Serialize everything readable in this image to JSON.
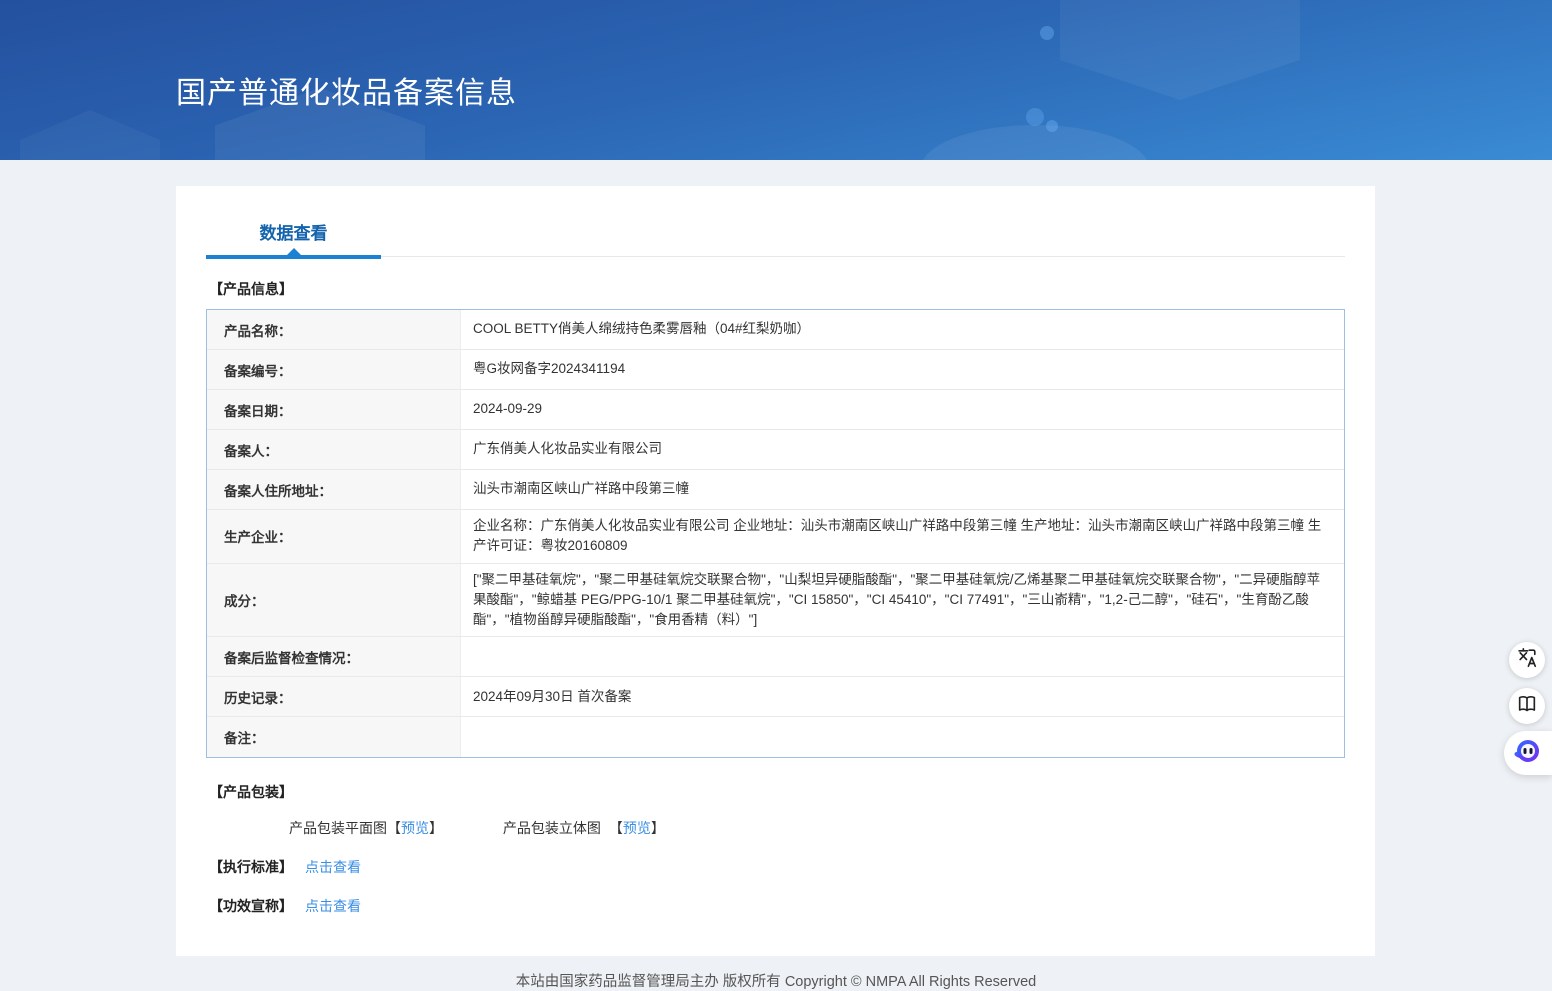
{
  "header": {
    "title": "国产普通化妆品备案信息"
  },
  "tabs": {
    "data_view": "数据查看"
  },
  "product_info": {
    "section_title": "【产品信息】",
    "rows": [
      {
        "label": "产品名称：",
        "value": "COOL BETTY俏美人绵绒持色柔雾唇釉（04#红梨奶咖）"
      },
      {
        "label": "备案编号：",
        "value": "粤G妆网备字2024341194"
      },
      {
        "label": "备案日期：",
        "value": "2024-09-29"
      },
      {
        "label": "备案人：",
        "value": "广东俏美人化妆品实业有限公司"
      },
      {
        "label": "备案人住所地址：",
        "value": "汕头市潮南区峡山广祥路中段第三幢"
      },
      {
        "label": "生产企业：",
        "value": "企业名称：广东俏美人化妆品实业有限公司 企业地址：汕头市潮南区峡山广祥路中段第三幢 生产地址：汕头市潮南区峡山广祥路中段第三幢 生产许可证：粤妆20160809"
      },
      {
        "label": "成分：",
        "value": "[\"聚二甲基硅氧烷\"，\"聚二甲基硅氧烷交联聚合物\"，\"山梨坦异硬脂酸酯\"，\"聚二甲基硅氧烷/乙烯基聚二甲基硅氧烷交联聚合物\"，\"二异硬脂醇苹果酸酯\"，\"鲸蜡基 PEG/PPG-10/1 聚二甲基硅氧烷\"，\"CI 15850\"，\"CI 45410\"，\"CI 77491\"，\"三山嵛精\"，\"1,2-己二醇\"，\"硅石\"，\"生育酚乙酸酯\"，\"植物甾醇异硬脂酸酯\"，\"食用香精（料）\"]"
      },
      {
        "label": "备案后监督检查情况：",
        "value": ""
      },
      {
        "label": "历史记录：",
        "value": "2024年09月30日 首次备案"
      },
      {
        "label": "备注：",
        "value": ""
      }
    ]
  },
  "packaging": {
    "section_title": "【产品包装】",
    "flat_label": "产品包装平面图",
    "stereo_label": "产品包装立体图",
    "bracket_open": "【",
    "preview_link": "预览",
    "bracket_close": "】"
  },
  "standards": {
    "label": "【执行标准】",
    "link": "点击查看"
  },
  "efficacy": {
    "label": "【功效宣称】",
    "link": "点击查看"
  },
  "floating_buttons": {
    "translate": "translate-icon",
    "reader": "book-reader-icon",
    "assistant": "ai-assistant-icon"
  },
  "footer": {
    "text": "本站由国家药品监督管理局主办 版权所有 Copyright © NMPA All Rights Reserved"
  },
  "colors": {
    "header_gradient_from": "#24509f",
    "header_gradient_to": "#3a8bd4",
    "tab_text": "#1464ad",
    "tab_underline": "#1b81d2",
    "link": "#3a8ee6",
    "table_border": "#9dbfe4",
    "label_cell_bg": "#f7f7f7",
    "page_bg": "#eef1f5"
  }
}
